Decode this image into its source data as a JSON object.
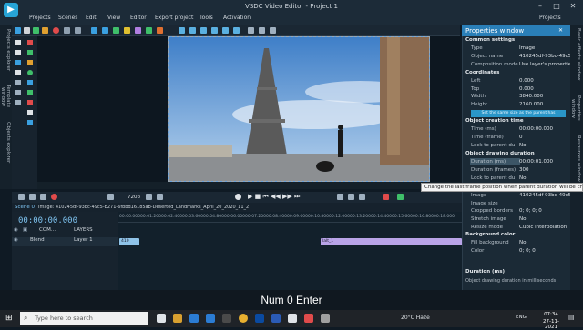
{
  "window": {
    "title": "VSDC Video Editor - Project 1",
    "menu": [
      "Projects",
      "Scenes",
      "Edit",
      "View",
      "Editor",
      "Export project",
      "Tools",
      "Activation"
    ],
    "projects_button": "Projects",
    "logo_glyph": "▶"
  },
  "side_tabs": [
    "Projects explorer",
    "Template window",
    "Objects explorer"
  ],
  "right_tabs": [
    "Basic effects window",
    "Properties window",
    "Resources window"
  ],
  "timeline": {
    "scene_tab": "Scene 0",
    "image_tab": "Image: 410245df-93bc-49c5-b271-6fbbd16185ab-Deserted_Landmarks_April_20_2020_11_2",
    "zoom": "720p",
    "timecode": "00:00:00.000",
    "ruler": [
      "00:00.000",
      "00:01.200",
      "00:02.400",
      "00:03.600",
      "00:04.800",
      "00:06.000",
      "00:07.200",
      "00:08.400",
      "00:09.600",
      "00:10.800",
      "00:12.000",
      "00:13.200",
      "00:14.400",
      "00:15.600",
      "00:16.800",
      "00:18.000"
    ],
    "tracks": [
      {
        "name": "COM...",
        "layer": "LAYERS"
      },
      {
        "name": "Blend",
        "layer": "Layer 1"
      }
    ],
    "clips": [
      "410",
      "lalt_1"
    ]
  },
  "properties": {
    "title": "Properties window",
    "sections": {
      "common": "Common settings",
      "coordinates": "Coordinates",
      "creation": "Object creation time",
      "drawing": "Object drawing duration",
      "bg": "Background color"
    },
    "rows": {
      "type_label": "Type",
      "type_val": "Image",
      "objname_label": "Object name",
      "objname_val": "410245df-93bc-49c5-b...",
      "comp_label": "Composition mode",
      "comp_val": "Use layer's properties",
      "left_label": "Left",
      "left_val": "0.000",
      "top_label": "Top",
      "top_val": "0.000",
      "width_label": "Width",
      "width_val": "3840.000",
      "height_label": "Height",
      "height_val": "2160.000",
      "set_same": "Set the same size as the parent has",
      "time_ms_label": "Time (ms)",
      "time_ms_val": "00:00:00.000",
      "time_frame_label": "Time (frame)",
      "time_frame_val": "0",
      "lock1_label": "Lock to parent du",
      "lock1_val": "No",
      "dur_ms_label": "Duration (ms)",
      "dur_ms_val": "00:00:01.000",
      "dur_fr_label": "Duration (frames)",
      "dur_fr_val": "300",
      "lock2_label": "Lock to parent du",
      "lock2_val": "No",
      "image_label": "Image",
      "image_val": "410245df-93bc-49c5-b...",
      "imgsize_label": "Image size",
      "imgsize_val": "",
      "cropped_label": "Cropped borders",
      "cropped_val": "0; 0; 0; 0",
      "stretch_label": "Stretch image",
      "stretch_val": "No",
      "resize_label": "Resize mode",
      "resize_val": "Cubic interpolation",
      "fillbg_label": "Fill background",
      "fillbg_val": "No",
      "color_label": "Color",
      "color_val": "0; 0; 0"
    },
    "footer_title": "Duration (ms)",
    "footer_text": "Object drawing duration in milliseconds"
  },
  "tooltip": "Change the last frame position when parent duration will be changed",
  "key_overlay": "Num 0 Enter",
  "taskbar": {
    "search_placeholder": "Type here to search",
    "weather": "20°C Haze",
    "lang": "ENG",
    "time": "07:34",
    "date": "27-11-2021"
  },
  "colors": {
    "accent": "#2a7fb8",
    "clip_purple": "#b9a4e8",
    "clip_blue": "#8fc3e8"
  }
}
